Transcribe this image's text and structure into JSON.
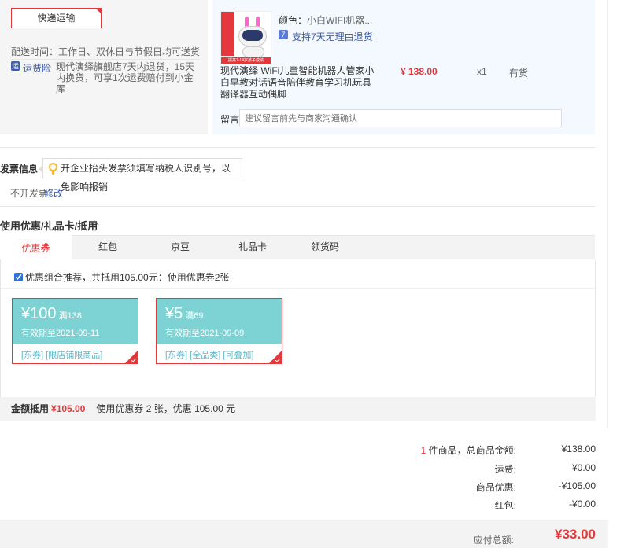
{
  "shipping": {
    "method_button": "快递运输",
    "delivery_time": "配送时间：工作日、双休日与节假日均可送货",
    "insurance_badge": "运",
    "insurance_label": "运费险",
    "insurance_text": "现代演绎旗舰店7天内退货，15天内换货，可享1次运费赔付到小金库"
  },
  "product": {
    "image_banner": "提高1-14岁孩子成绩",
    "color_label": "颜色：",
    "color_value": "小白WIFI机器...",
    "return_badge": "7",
    "return_text": "支持7天无理由退货",
    "title": "现代演绎 WiFi儿童智能机器人管家小白早教对话语音陪伴教育学习机玩具翻译器互动偶脚",
    "price": "¥ 138.00",
    "quantity": "x1",
    "stock": "有货"
  },
  "note": {
    "label": "留言:",
    "placeholder": "建议留言前先与商家沟通确认"
  },
  "invoice": {
    "title": "发票信息",
    "tip": "开企业抬头发票须填写纳税人识别号，以免影响报销",
    "status": "不开发票",
    "edit": "修改"
  },
  "coupons": {
    "section_title": "使用优惠/礼品卡/抵用",
    "tabs": [
      {
        "label": "优惠券",
        "active": true
      },
      {
        "label": "红包",
        "active": false
      },
      {
        "label": "京豆",
        "active": false
      },
      {
        "label": "礼品卡",
        "active": false
      },
      {
        "label": "领货码",
        "active": false
      }
    ],
    "combo_text": "优惠组合推荐，共抵用105.00元：使用优惠券2张",
    "combo_checked": true,
    "items": [
      {
        "amount": "¥100",
        "condition": "满138",
        "valid": "有效期至2021-09-11",
        "tags": "[东券]  [限店铺限商品]"
      },
      {
        "amount": "¥5",
        "condition": "满69",
        "valid": "有效期至2021-09-09",
        "tags": "[东券]  [全品类]  [可叠加]"
      }
    ],
    "summary_key": "金额抵用",
    "summary_value": "¥105.00",
    "summary_desc": "使用优惠券 2 张，优惠 105.00 元"
  },
  "totals": {
    "items_count": "1",
    "items_label": " 件商品，总商品金额:",
    "items_value": "¥138.00",
    "shipping_label": "运费:",
    "shipping_value": "¥0.00",
    "discount_label": "商品优惠:",
    "discount_value": "-¥105.00",
    "redpacket_label": "红包:",
    "redpacket_value": "-¥0.00",
    "payable_label": "应付总额:",
    "payable_value": "¥33.00"
  },
  "colors": {
    "accent_red": "#e4393c",
    "coupon_teal": "#7dd3d3",
    "link_blue": "#3b5ba9"
  }
}
